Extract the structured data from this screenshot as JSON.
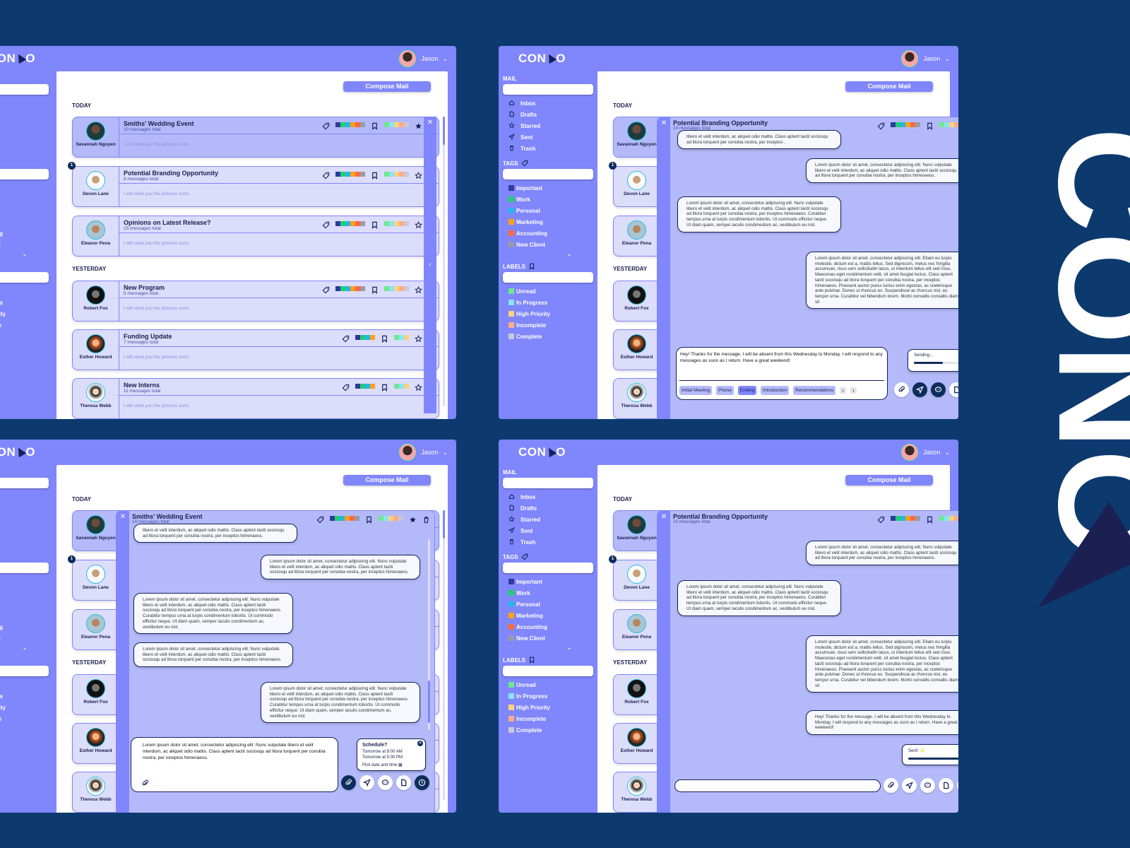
{
  "brand": {
    "logo_text_left": "CON",
    "logo_text_right": "O",
    "vertical_wordmark": "CONO"
  },
  "user": {
    "name": "Jason"
  },
  "compose_label": "Compose Mail",
  "sections": {
    "today": "TODAY",
    "yesterday": "YESTERDAY"
  },
  "sidebar": {
    "mail_label": "MAIL",
    "tags_label": "TAGS",
    "labels_label": "LABELS",
    "mail_items": [
      {
        "label": "Inbox",
        "icon": "home-icon"
      },
      {
        "label": "Drafts",
        "icon": "file-icon"
      },
      {
        "label": "Starred",
        "icon": "star-icon"
      },
      {
        "label": "Sent",
        "icon": "send-icon"
      },
      {
        "label": "Trash",
        "icon": "trash-icon"
      }
    ],
    "tags": [
      {
        "label": "Important",
        "color": "#2e3a9e"
      },
      {
        "label": "Work",
        "color": "#1fcf6f"
      },
      {
        "label": "Personal",
        "color": "#20b8e6"
      },
      {
        "label": "Marketing",
        "color": "#ff9f1c"
      },
      {
        "label": "Accounting",
        "color": "#ff6a3d"
      },
      {
        "label": "New Client",
        "color": "#9a9aa8"
      }
    ],
    "labels": [
      {
        "label": "Unread",
        "color": "#6ee88f"
      },
      {
        "label": "In Progress",
        "color": "#86e6f5"
      },
      {
        "label": "High Priority",
        "color": "#ffd27a"
      },
      {
        "label": "Incomplete",
        "color": "#ffab8a"
      },
      {
        "label": "Complete",
        "color": "#c9c9d6"
      }
    ]
  },
  "emails": [
    {
      "sender": "Savannah Nguyen",
      "subject": "Smiths' Wedding Event",
      "count": "10 messages total",
      "preview": "I will send you the pictures soon.",
      "starred": true,
      "group": "today"
    },
    {
      "sender": "Devon Lane",
      "subject": "Potential Branding Opportunity",
      "count": "8 messages total",
      "preview": "I will send you the pictures soon.",
      "starred": false,
      "unread_badge": "1",
      "group": "today"
    },
    {
      "sender": "Eleanor Pena",
      "subject": "Opinions on Latest Release?",
      "count": "15 messages total",
      "preview": "I will send you the pictures soon.",
      "starred": false,
      "group": "today"
    },
    {
      "sender": "Robert Fox",
      "subject": "New Program",
      "count": "5 messages total",
      "preview": "I will send you the pictures soon.",
      "starred": false,
      "group": "yesterday"
    },
    {
      "sender": "Esther Howard",
      "subject": "Funding Update",
      "count": "7 messages total",
      "preview": "I will send you the pictures soon.",
      "starred": false,
      "group": "yesterday"
    },
    {
      "sender": "Theresa Webb",
      "subject": "New Interns",
      "count": "11 messages total",
      "preview": "I will send you the pictures soon.",
      "starred": false,
      "group": "yesterday"
    }
  ],
  "threads": {
    "branding": {
      "title": "Potential Branding Opportunity",
      "count": "10 messages total"
    },
    "wedding": {
      "title": "Smiths' Wedding Event",
      "count": "10 messages total"
    }
  },
  "messages": {
    "partial_short": "libero et velit interdum, ac aliquet odio mattis. Class aptent taciti sociosqu ad litora torquent per conubia nostra, per inceptos .",
    "partial_short2": "libero et velit interdum, ac aliquet odio mattis. Class aptent taciti sociosqu ad litora torquent per conubia nostra, per inceptos himenaeos.",
    "short": "Lorem ipsum dolor sit amet, consectetur adipiscing elit. Nunc vulputate libero et velit interdum, ac aliquet odio mattis. Class aptent taciti sociosqu ad litora torquent per conubia nostra, per inceptos himenaeos.",
    "medium": "Lorem ipsum dolor sit amet, consectetur adipiscing elit. Nunc vulputate libero et velit interdum, ac aliquet odio mattis. Class aptent taciti sociosqu ad litora torquent per conubia nostra, per inceptos himenaeos. Curabitur tempus urna at turpis condimentum lobortis. Ut commodo efficitur neque. Ut diam quam, semper iaculis condimentum ac, vestibulum eu nisl.",
    "long": "Lorem ipsum dolor sit amet, consectetur adipiscing elit. Etiam eu turpis molestie, dictum est a, mattis tellus. Sed dignissim, metus nec fringilla accumsan, risus sem sollicitudin lacus, ut interdum tellus elit sed risus. Maecenas eget condimentum velit, sit amet feugiat lectus. Class aptent taciti sociosqu ad litora torquent per conubia nostra, per inceptos himenaeos. Praesent auctor purus luctus enim egestas, ac scelerisque ante pulvinar. Donec ut rhoncus ex. Suspendisse ac rhoncus nisl, eu tempor urna. Curabitur vel bibendum lorem. Morbi convallis convallis diam sit",
    "reply": "Hey! Thanks for the message. I will be absent from this Wednesday to Monday. I will respond to any messages as soon as I return. Have a great weekend!",
    "draft": "Lorem ipsum dolor sit amet, consectetur adipiscing elit. Nunc vulputate libero et velit interdum, ac aliquet odio mattis. Class aptent taciti sociosqu ad litora torquent per conubia nostra, per inceptos himenaeos."
  },
  "templates": [
    "Initial Meeting",
    "Phone",
    "Ending",
    "Introduction",
    "Recommendations"
  ],
  "templates_selected": "Ending",
  "sending_toast": {
    "label": "Sending...",
    "progress": 0.55
  },
  "sent_toast": {
    "label": "Sent! ✨",
    "progress": 1.0
  },
  "schedule": {
    "title": "Schedule?",
    "options": [
      "Tomorrow at 8:00 AM",
      "Tomorrow at 5:00 PM"
    ],
    "pick": "Pick date and time"
  },
  "colors": {
    "background": "#0c3a6e",
    "accent": "#8086fb",
    "dark": "#0d2d5c",
    "thread_bg": "#b4baf9",
    "card_bg": "#dcdcfb"
  }
}
